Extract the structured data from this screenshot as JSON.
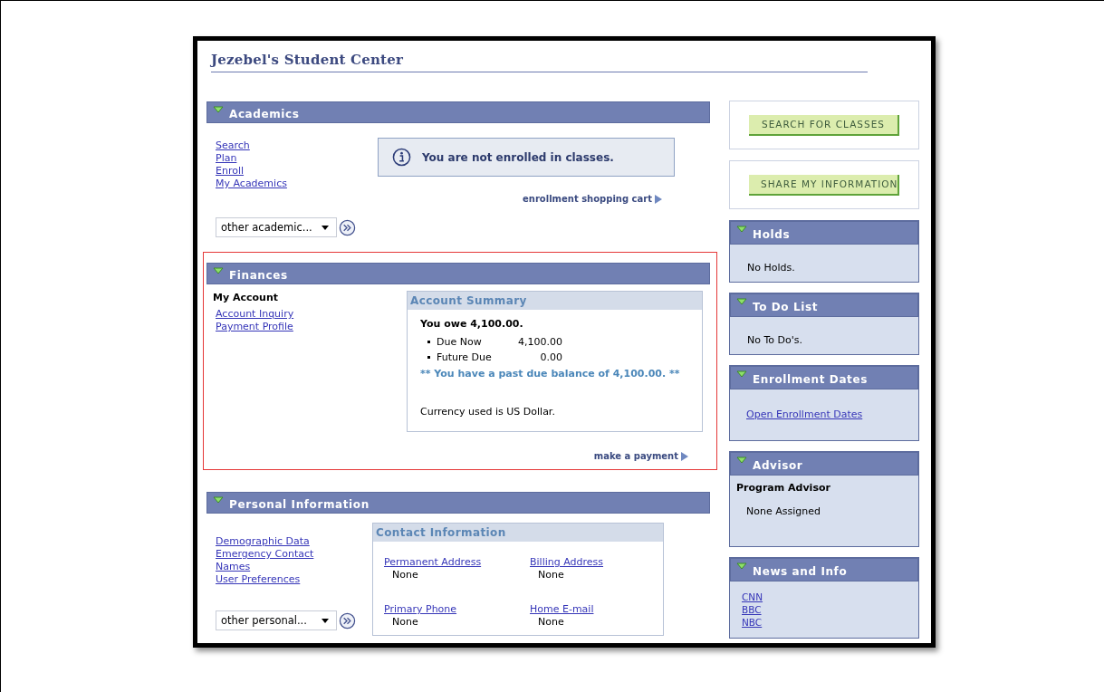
{
  "title": "Jezebel's Student Center",
  "sections": [
    {
      "kind": "academics",
      "title": "Academics",
      "expanded": true,
      "highlighted": false,
      "links": [
        "Search",
        "Plan",
        "Enroll",
        "My Academics"
      ],
      "notice": "You are not enrolled in classes.",
      "action_link": "enrollment shopping cart",
      "dropdown": {
        "value": "other academic..."
      }
    },
    {
      "kind": "finances",
      "title": "Finances",
      "expanded": true,
      "highlighted": true,
      "group_label": "My Account",
      "links": [
        "Account Inquiry",
        "Payment Profile"
      ],
      "summary": {
        "title": "Account Summary",
        "owe": "You owe 4,100.00.",
        "items": [
          {
            "label": "Due Now",
            "amount": "4,100.00"
          },
          {
            "label": "Future Due",
            "amount": "0.00"
          }
        ],
        "warning": "** You have a past due balance of 4,100.00. **",
        "currency": "Currency used is US Dollar."
      },
      "action_link": "make a payment"
    },
    {
      "kind": "personal",
      "title": "Personal Information",
      "expanded": true,
      "highlighted": false,
      "links": [
        "Demographic Data",
        "Emergency Contact",
        "Names",
        "User Preferences"
      ],
      "contact": {
        "title": "Contact Information",
        "fields": [
          {
            "label": "Permanent Address",
            "value": "None"
          },
          {
            "label": "Billing Address",
            "value": "None"
          },
          {
            "label": "Primary Phone",
            "value": "None"
          },
          {
            "label": "Home E-mail",
            "value": "None"
          }
        ]
      },
      "dropdown": {
        "value": "other personal..."
      }
    }
  ],
  "buttons": [
    "SEARCH FOR CLASSES",
    "SHARE MY INFORMATION"
  ],
  "side_panels": [
    {
      "kind": "text",
      "title": "Holds",
      "expanded": true,
      "text": "No Holds."
    },
    {
      "kind": "text",
      "title": "To Do List",
      "expanded": true,
      "text": "No To Do's."
    },
    {
      "kind": "links",
      "title": "Enrollment Dates",
      "expanded": true,
      "links": [
        "Open Enrollment Dates"
      ]
    },
    {
      "kind": "advisor",
      "title": "Advisor",
      "expanded": true,
      "label": "Program Advisor",
      "text": "None Assigned"
    },
    {
      "kind": "news",
      "title": "News and Info",
      "expanded": true,
      "links": [
        "CNN",
        "BBC",
        "NBC"
      ]
    }
  ]
}
